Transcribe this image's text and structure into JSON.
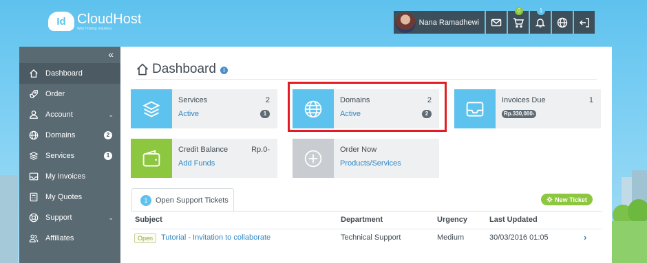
{
  "brand": {
    "name": "CloudHost",
    "badge": "Id",
    "tagline": "Web Hosting Solutions"
  },
  "header": {
    "user_name": "Nana Ramadhewi",
    "cart_count": "0",
    "notification_count": "1",
    "cart_badge_color": "#8dc63f",
    "notification_badge_color": "#5ec2ee"
  },
  "sidebar": {
    "collapse_glyph": "«",
    "items": [
      {
        "label": "Dashboard",
        "icon": "home-icon",
        "active": true
      },
      {
        "label": "Order",
        "icon": "rocket-icon"
      },
      {
        "label": "Account",
        "icon": "user-icon",
        "caret": "⌄"
      },
      {
        "label": "Domains",
        "icon": "globe-icon",
        "count": "2"
      },
      {
        "label": "Services",
        "icon": "layers-icon",
        "count": "1"
      },
      {
        "label": "My Invoices",
        "icon": "inbox-icon"
      },
      {
        "label": "My Quotes",
        "icon": "calculator-icon"
      },
      {
        "label": "Support",
        "icon": "lifebuoy-icon",
        "caret": "⌄"
      },
      {
        "label": "Affiliates",
        "icon": "users-icon"
      }
    ]
  },
  "main": {
    "title": "Dashboard",
    "info_glyph": "i",
    "tiles": [
      {
        "label": "Services",
        "count": "2",
        "link": "Active",
        "pill": "1",
        "icon": "layers-icon",
        "color": "#5ec2ee"
      },
      {
        "label": "Domains",
        "count": "2",
        "link": "Active",
        "pill": "2",
        "icon": "globe-icon",
        "color": "#5ec2ee"
      },
      {
        "label": "Invoices Due",
        "count": "1",
        "pill": "Rp.330,000-",
        "icon": "inbox-icon",
        "color": "#5ec2ee"
      },
      {
        "label": "Credit Balance",
        "count": "Rp.0-",
        "link": "Add Funds",
        "icon": "wallet-icon",
        "color": "#8dc63f"
      },
      {
        "label": "Order Now",
        "link": "Products/Services",
        "icon": "plus-circle-icon",
        "color": "#c9ccd0"
      }
    ],
    "tickets": {
      "tab_count": "1",
      "tab_label": "Open Support Tickets",
      "new_ticket_label": "New Ticket",
      "columns": [
        "Subject",
        "Department",
        "Urgency",
        "Last Updated"
      ],
      "rows": [
        {
          "status": "Open",
          "subject": "Tutorial - Invitation to collaborate",
          "department": "Technical Support",
          "urgency": "Medium",
          "last_updated": "30/03/2016 01:05",
          "arrow": "›"
        }
      ]
    }
  }
}
